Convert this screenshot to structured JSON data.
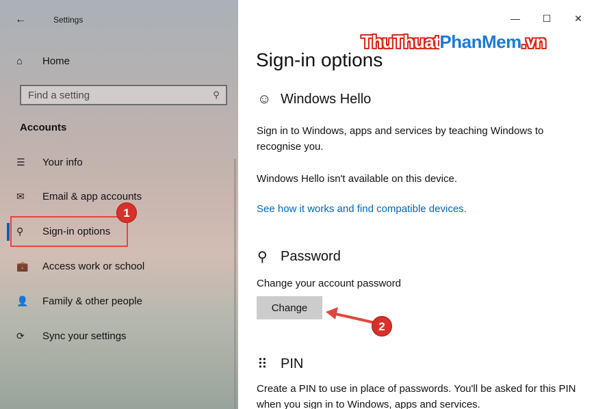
{
  "window": {
    "app_title": "Settings",
    "back_icon": "←",
    "controls": {
      "minimize": "—",
      "maximize": "☐",
      "close": "✕"
    }
  },
  "watermark": {
    "part1": "ThuThuat",
    "part2": "PhanMem",
    "part3": ".vn"
  },
  "sidebar": {
    "home": {
      "icon": "⌂",
      "label": "Home"
    },
    "search": {
      "placeholder": "Find a setting",
      "icon": "⚲"
    },
    "section_heading": "Accounts",
    "items": [
      {
        "icon": "☰",
        "label": "Your info"
      },
      {
        "icon": "✉",
        "label": "Email & app accounts"
      },
      {
        "icon": "⚲",
        "label": "Sign-in options",
        "active": true
      },
      {
        "icon": "💼",
        "label": "Access work or school"
      },
      {
        "icon": "👤",
        "label": "Family & other people"
      },
      {
        "icon": "⟳",
        "label": "Sync your settings"
      }
    ]
  },
  "annotations": {
    "badge1": "1",
    "badge2": "2",
    "marker_color": "#e2463f"
  },
  "main": {
    "page_title": "Sign-in options",
    "windows_hello": {
      "icon": "☺",
      "heading": "Windows Hello",
      "description": "Sign in to Windows, apps and services by teaching Windows to recognise you.",
      "status": "Windows Hello isn't available on this device.",
      "link": "See how it works and find compatible devices."
    },
    "password": {
      "icon": "⚲",
      "heading": "Password",
      "description": "Change your account password",
      "button": "Change"
    },
    "pin": {
      "icon": "⠿",
      "heading": "PIN",
      "description": "Create a PIN to use in place of passwords. You'll be asked for this PIN when you sign in to Windows, apps and services."
    }
  },
  "colors": {
    "accent": "#0063b1",
    "link": "#0067b8",
    "button_bg": "#cccccc"
  }
}
